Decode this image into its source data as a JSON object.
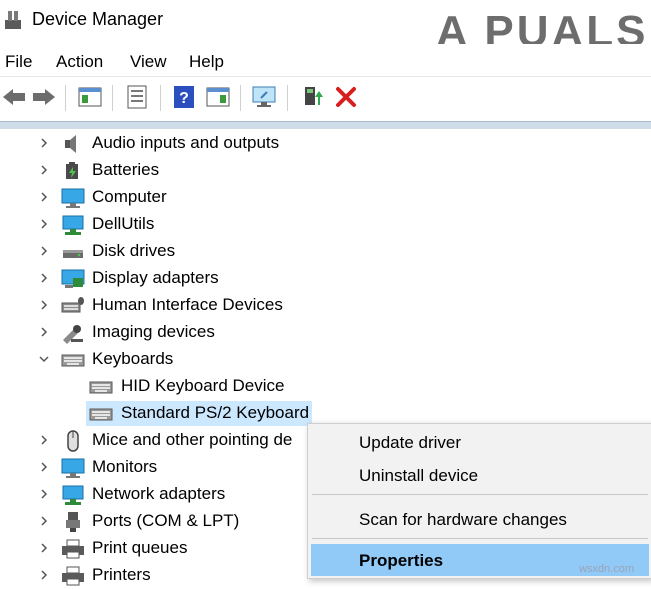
{
  "window": {
    "title": "Device Manager",
    "watermark": "A PUALS"
  },
  "menu": [
    "File",
    "Action",
    "View",
    "Help"
  ],
  "toolbar": {
    "buttons": [
      "back-arrow-icon",
      "forward-arrow-icon",
      "show-hide-console-tree-icon",
      "properties-icon",
      "help-icon",
      "action-pane-icon",
      "scan-hardware-icon",
      "update-driver-icon",
      "uninstall-icon"
    ]
  },
  "tree": {
    "items": [
      {
        "label": "Audio inputs and outputs",
        "icon": "speaker-icon"
      },
      {
        "label": "Batteries",
        "icon": "battery-icon"
      },
      {
        "label": "Computer",
        "icon": "computer-icon"
      },
      {
        "label": "DellUtils",
        "icon": "network-monitor-icon"
      },
      {
        "label": "Disk drives",
        "icon": "disk-drive-icon"
      },
      {
        "label": "Display adapters",
        "icon": "display-adapter-icon"
      },
      {
        "label": "Human Interface Devices",
        "icon": "hid-icon"
      },
      {
        "label": "Imaging devices",
        "icon": "camera-icon"
      },
      {
        "label": "Keyboards",
        "icon": "keyboard-icon",
        "expanded": true
      },
      {
        "label": "HID Keyboard Device",
        "icon": "keyboard-icon",
        "child": true
      },
      {
        "label": "Standard PS/2 Keyboard",
        "icon": "keyboard-icon",
        "child": true,
        "selected": true
      },
      {
        "label": "Mice and other pointing de",
        "icon": "mouse-icon"
      },
      {
        "label": "Monitors",
        "icon": "monitor-icon"
      },
      {
        "label": "Network adapters",
        "icon": "network-adapter-icon"
      },
      {
        "label": "Ports (COM & LPT)",
        "icon": "port-icon"
      },
      {
        "label": "Print queues",
        "icon": "printer-icon"
      },
      {
        "label": "Printers",
        "icon": "printer-icon"
      }
    ]
  },
  "context_menu": {
    "items": [
      "Update driver",
      "Uninstall device",
      "Scan for hardware changes",
      "Properties"
    ],
    "highlighted": "Properties"
  },
  "source_mark": "wsxdn.com"
}
